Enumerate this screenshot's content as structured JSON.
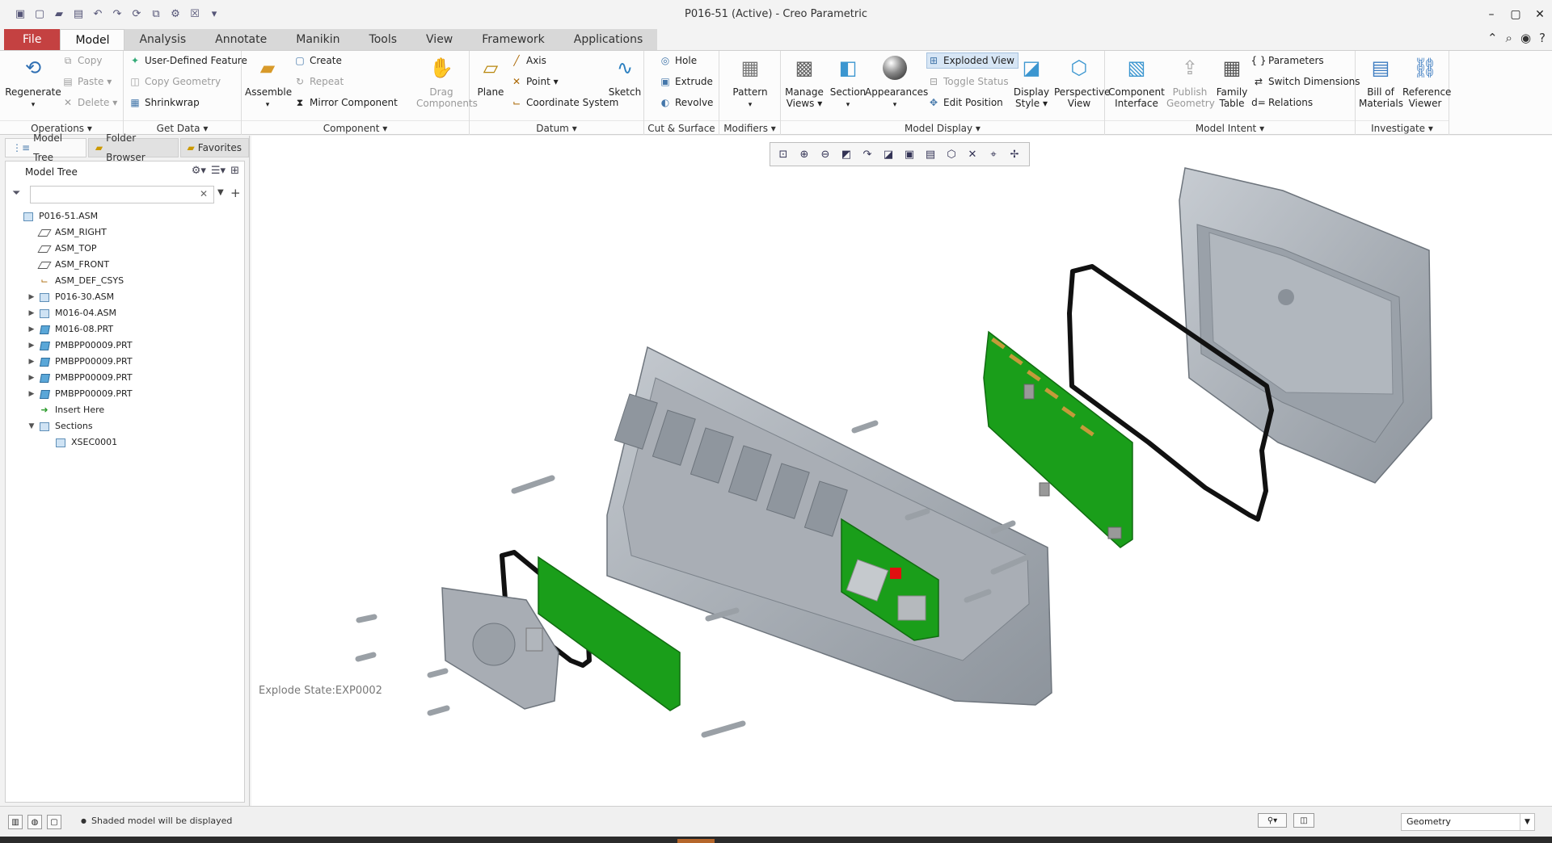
{
  "window": {
    "title": "P016-51 (Active) - Creo Parametric"
  },
  "tabs": [
    "File",
    "Model",
    "Analysis",
    "Annotate",
    "Manikin",
    "Tools",
    "View",
    "Framework",
    "Applications"
  ],
  "ribbon": {
    "operations": {
      "label": "Operations",
      "regenerate": "Regenerate",
      "copy": "Copy",
      "paste": "Paste",
      "delete": "Delete"
    },
    "get_data": {
      "label": "Get Data",
      "udf": "User-Defined Feature",
      "copy_geometry": "Copy Geometry",
      "shrinkwrap": "Shrinkwrap"
    },
    "component": {
      "label": "Component",
      "assemble": "Assemble",
      "create": "Create",
      "repeat": "Repeat",
      "mirror": "Mirror Component",
      "drag1": "Drag",
      "drag2": "Components"
    },
    "datum": {
      "label": "Datum",
      "plane": "Plane",
      "axis": "Axis",
      "point": "Point",
      "csys": "Coordinate System",
      "sketch": "Sketch"
    },
    "cut_surface": {
      "label": "Cut & Surface",
      "hole": "Hole",
      "extrude": "Extrude",
      "revolve": "Revolve"
    },
    "modifiers": {
      "label": "Modifiers",
      "pattern": "Pattern"
    },
    "model_display": {
      "label": "Model Display",
      "manage1": "Manage",
      "manage2": "Views",
      "section": "Section",
      "appearances": "Appearances",
      "exploded": "Exploded View",
      "toggle": "Toggle Status",
      "edit_pos": "Edit Position",
      "display1": "Display",
      "display2": "Style",
      "persp1": "Perspective",
      "persp2": "View"
    },
    "model_intent": {
      "label": "Model Intent",
      "ci1": "Component",
      "ci2": "Interface",
      "pg1": "Publish",
      "pg2": "Geometry",
      "ft1": "Family",
      "ft2": "Table",
      "parameters": "Parameters",
      "switch_dims": "Switch Dimensions",
      "relations": "Relations"
    },
    "investigate": {
      "label": "Investigate",
      "bom1": "Bill of",
      "bom2": "Materials",
      "rv1": "Reference",
      "rv2": "Viewer"
    }
  },
  "panel": {
    "tabs": [
      "Model Tree",
      "Folder Browser",
      "Favorites"
    ],
    "header": "Model Tree",
    "search_placeholder": "",
    "tree": [
      {
        "label": "P016-51.ASM",
        "icon": "asm",
        "level": 0,
        "expander": ""
      },
      {
        "label": "ASM_RIGHT",
        "icon": "plane",
        "level": 1,
        "expander": ""
      },
      {
        "label": "ASM_TOP",
        "icon": "plane",
        "level": 1,
        "expander": ""
      },
      {
        "label": "ASM_FRONT",
        "icon": "plane",
        "level": 1,
        "expander": ""
      },
      {
        "label": "ASM_DEF_CSYS",
        "icon": "csys",
        "level": 1,
        "expander": ""
      },
      {
        "label": "P016-30.ASM",
        "icon": "asm",
        "level": 1,
        "expander": "▶"
      },
      {
        "label": "M016-04.ASM",
        "icon": "asm",
        "level": 1,
        "expander": "▶"
      },
      {
        "label": "M016-08.PRT",
        "icon": "prt",
        "level": 1,
        "expander": "▶"
      },
      {
        "label": "PMBPP00009.PRT",
        "icon": "prt",
        "level": 1,
        "expander": "▶"
      },
      {
        "label": "PMBPP00009.PRT",
        "icon": "prt",
        "level": 1,
        "expander": "▶"
      },
      {
        "label": "PMBPP00009.PRT",
        "icon": "prt",
        "level": 1,
        "expander": "▶"
      },
      {
        "label": "PMBPP00009.PRT",
        "icon": "prt",
        "level": 1,
        "expander": "▶"
      },
      {
        "label": "Insert Here",
        "icon": "insert",
        "level": 1,
        "expander": ""
      },
      {
        "label": "Sections",
        "icon": "sections",
        "level": 1,
        "expander": "▼"
      },
      {
        "label": "XSEC0001",
        "icon": "section",
        "level": 2,
        "expander": ""
      }
    ]
  },
  "viewport": {
    "explode_state": "Explode State:EXP0002"
  },
  "status": {
    "message": "Shaded model will be displayed",
    "selection_filter": "Geometry"
  },
  "colors": {
    "file_tab": "#c44141",
    "pcb_green": "#1a9e1a",
    "housing_gray": "#a9b0b8"
  }
}
